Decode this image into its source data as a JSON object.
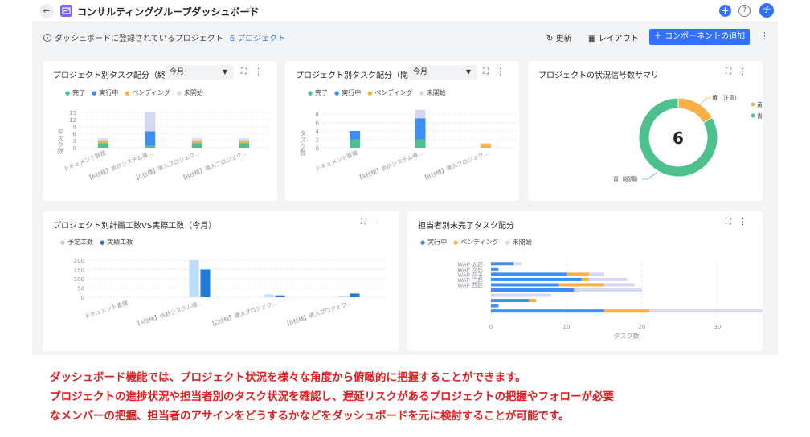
{
  "header": {
    "title": "コンサルティンググループダッシュボード",
    "avatar": "子"
  },
  "toolbar": {
    "info": "ダッシュボードに登録されているプロジェクト",
    "count": "6 プロジェクト",
    "refresh": "更新",
    "layout": "レイアウト",
    "add": "コンポーネントの追加"
  },
  "cards": {
    "task_by_project": {
      "title": "プロジェクト別タスク配分（終...",
      "filter": "今月"
    },
    "task_by_project2": {
      "title": "プロジェクト別タスク配分（閲...",
      "filter": "今月"
    },
    "signal": {
      "title": "プロジェクトの状況信号数サマリ"
    },
    "plan_vs_actual": {
      "title": "プロジェクト別計画工数VS実際工数（今月）"
    },
    "assignee": {
      "title": "担当者別未完了タスク配分"
    }
  },
  "status_legend": {
    "done": "完了",
    "in_progress": "実行中",
    "pending": "ペンディング",
    "not_started": "未開始"
  },
  "effort_legend": {
    "planned": "予定工数",
    "actual": "実績工数"
  },
  "chart_data": [
    {
      "type": "bar",
      "stacked": true,
      "ylabel": "タスク数",
      "ylim": [
        0,
        15
      ],
      "yticks": [
        "15",
        "12",
        "9",
        "6",
        "3",
        "0"
      ],
      "categories": [
        "ドキュメント管理",
        "【A社様】会計システム導...",
        "【C社様】導入プロジェク...",
        "【B社様】導入プロジェク..."
      ],
      "series": [
        {
          "name": "完了",
          "values": [
            2,
            1,
            2,
            2
          ]
        },
        {
          "name": "実行中",
          "values": [
            0,
            6,
            0,
            0
          ]
        },
        {
          "name": "ペンディング",
          "values": [
            1,
            0,
            1,
            1
          ]
        },
        {
          "name": "未開始",
          "values": [
            1,
            8,
            1,
            1
          ]
        }
      ],
      "colors": [
        "#4cc08d",
        "#3d8ef0",
        "#f7b045",
        "#d4d8f2"
      ]
    },
    {
      "type": "bar",
      "stacked": true,
      "ylabel": "タスク数",
      "ylim": [
        0,
        8
      ],
      "yticks": [
        "8",
        "6",
        "4",
        "2",
        "0"
      ],
      "categories": [
        "ドキュメント管理",
        "【A社様】会計システム導...",
        "【B社様】導入プロジェク..."
      ],
      "series": [
        {
          "name": "完了",
          "values": [
            2,
            2,
            0
          ]
        },
        {
          "name": "実行中",
          "values": [
            2,
            5,
            0
          ]
        },
        {
          "name": "ペンディング",
          "values": [
            0,
            0,
            1
          ]
        },
        {
          "name": "未開始",
          "values": [
            0,
            2,
            0
          ]
        }
      ],
      "colors": [
        "#4cc08d",
        "#3d8ef0",
        "#f7b045",
        "#d4d8f2"
      ]
    },
    {
      "type": "pie",
      "donut": true,
      "center_label": "6",
      "slices": [
        {
          "name": "黄（注意）",
          "value": 1,
          "color": "#f7b045"
        },
        {
          "name": "青（順調）",
          "value": 5,
          "color": "#4cc08d"
        }
      ],
      "legend": [
        "黄（注",
        "青（順"
      ]
    },
    {
      "type": "bar",
      "ylim": [
        0,
        200
      ],
      "yticks": [
        "200",
        "150",
        "100",
        "50",
        "0"
      ],
      "categories": [
        "ドキュメント管理",
        "【A社様】会計システム導...",
        "【C社様】導入プロジェク...",
        "【B社様】導入プロジェク..."
      ],
      "series": [
        {
          "name": "予定工数",
          "values": [
            0,
            200,
            15,
            8
          ]
        },
        {
          "name": "実績工数",
          "values": [
            0,
            150,
            10,
            20
          ]
        }
      ],
      "colors": [
        "#bddcf9",
        "#1f7ad8"
      ]
    },
    {
      "type": "bar",
      "orientation": "horizontal",
      "stacked": true,
      "xlabel": "タスク数",
      "xlim": [
        0,
        38
      ],
      "xticks": [
        "0",
        "10",
        "20",
        "30",
        "38"
      ],
      "categories": [
        "WAP 太郎",
        "WAP 次郎",
        "WAP 花子",
        "WAP 三郎",
        "WAP 四郎",
        "",
        "",
        "",
        "",
        "",
        ""
      ],
      "series": [
        {
          "name": "実行中",
          "values": [
            3,
            1,
            10,
            12,
            9,
            11,
            0,
            5,
            1,
            15,
            0
          ]
        },
        {
          "name": "ペンディング",
          "values": [
            0,
            0,
            3,
            1,
            6,
            0,
            0,
            1,
            0,
            6,
            0
          ]
        },
        {
          "name": "未開始",
          "values": [
            1,
            0,
            2,
            5,
            4,
            9,
            8,
            0,
            0,
            17,
            0
          ]
        }
      ],
      "colors": [
        "#3d8ef0",
        "#f7b045",
        "#d4d8f2"
      ]
    }
  ],
  "caption": [
    "ダッシュボード機能では、プロジェクト状況を様々な角度から俯瞰的に把握することができます。",
    "プロジェクトの進捗状況や担当者別のタスク状況を確認し、遅延リスクがあるプロジェクトの把握やフォローが必要",
    "なメンバーの把握、担当者のアサインをどうするかなどをダッシュボードを元に検討することが可能です。"
  ]
}
